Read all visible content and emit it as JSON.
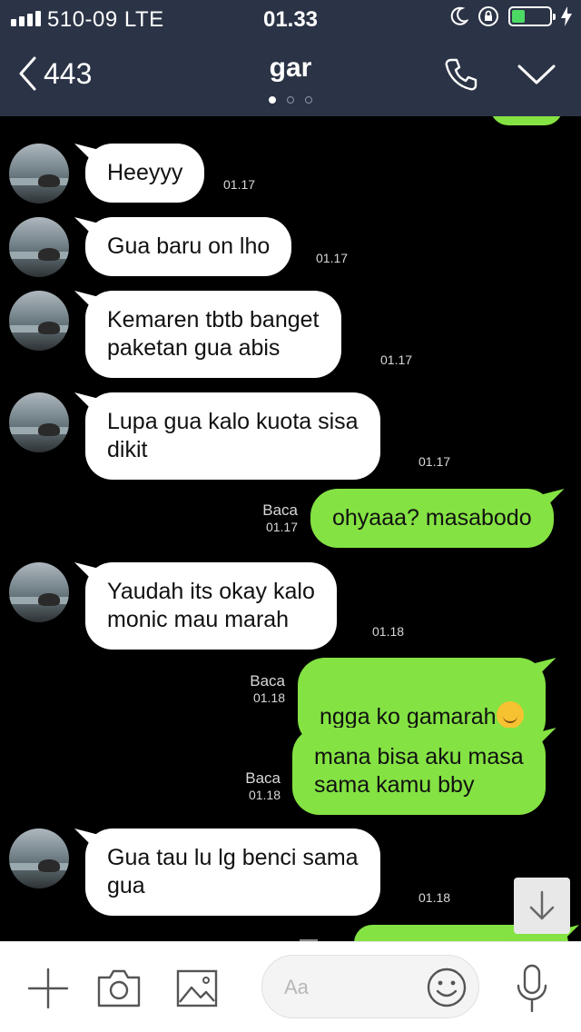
{
  "status_bar": {
    "carrier": "510-09  LTE",
    "time": "01.33"
  },
  "header": {
    "back_count": "443",
    "title": "gar",
    "page_dots": 3,
    "active_dot": 0,
    "icons": [
      "chevron-left-icon",
      "phone-icon",
      "chevron-down-icon"
    ]
  },
  "messages": [
    {
      "direction": "in",
      "text": "Heeyyy",
      "time": "01.17"
    },
    {
      "direction": "in",
      "text": "Gua baru on lho",
      "time": "01.17"
    },
    {
      "direction": "in",
      "text": "Kemaren tbtb banget\npaketan gua abis",
      "time": "01.17"
    },
    {
      "direction": "in",
      "text": "Lupa gua kalo kuota sisa\ndikit",
      "time": "01.17"
    },
    {
      "direction": "out",
      "text": "ohyaaa? masabodo",
      "time": "01.17",
      "read": "Baca"
    },
    {
      "direction": "in",
      "text": "Yaudah its okay kalo\nmonic mau marah",
      "time": "01.18"
    },
    {
      "direction": "out",
      "text": "ngga ko gamarah",
      "emoji": "smiling-face",
      "time": "01.18",
      "read": "Baca"
    },
    {
      "direction": "out",
      "text": "mana bisa aku masa\nsama kamu bby",
      "time": "01.18",
      "read": "Baca"
    },
    {
      "direction": "in",
      "text": "Gua tau lu lg benci sama\ngua",
      "time": "01.18"
    }
  ],
  "colors": {
    "header_bg": "#2b3446",
    "chat_bg": "#000000",
    "incoming_bubble": "#ffffff",
    "outgoing_bubble": "#84e243"
  },
  "input_bar": {
    "placeholder": "Aa",
    "icons": [
      "plus-icon",
      "camera-icon",
      "image-icon",
      "emoji-icon",
      "microphone-icon"
    ]
  }
}
